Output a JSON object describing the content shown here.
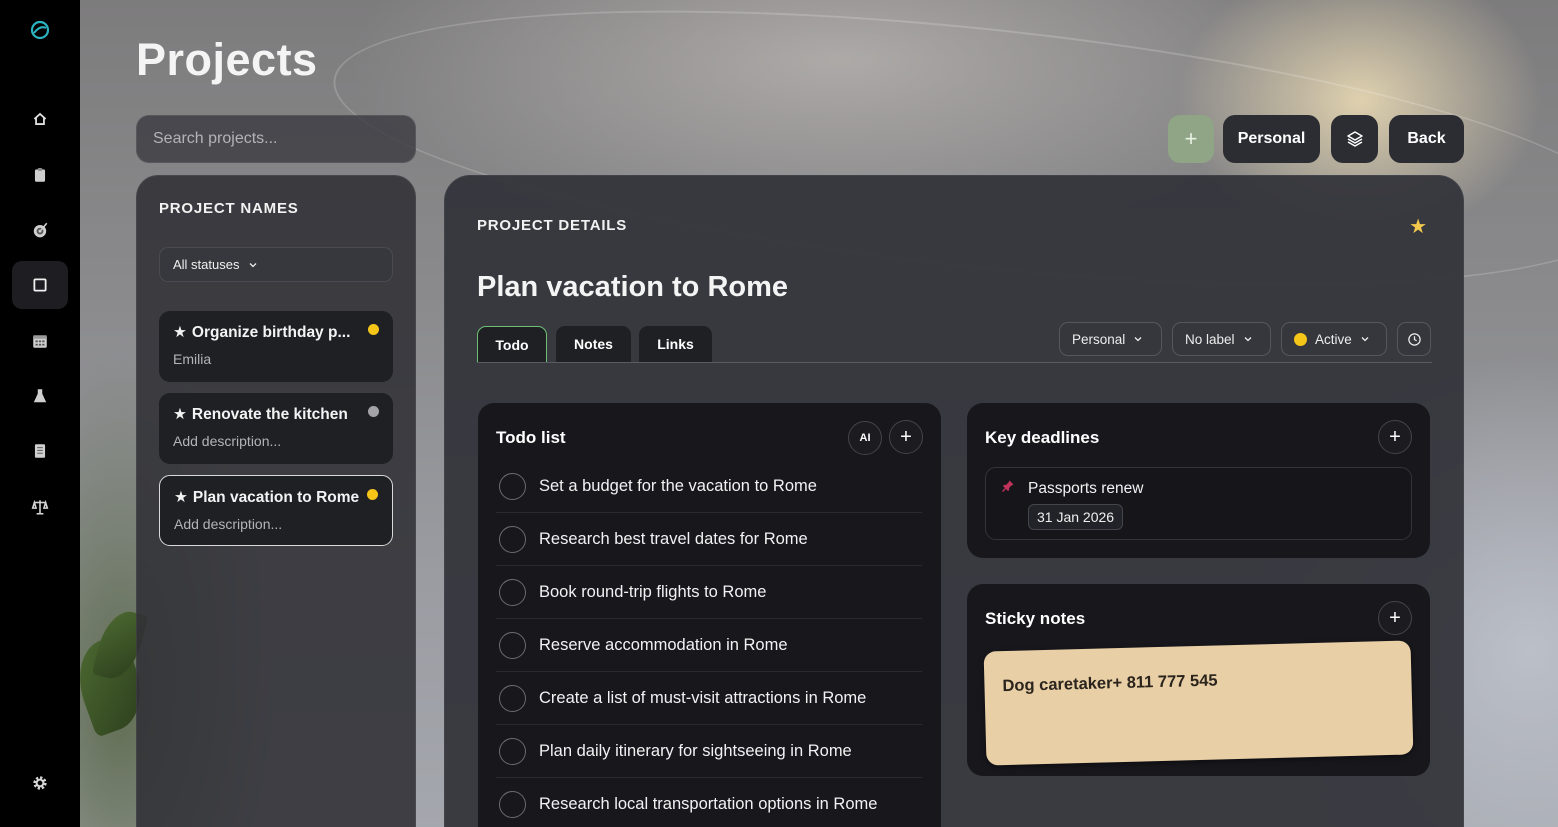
{
  "sidebar": {
    "items": [
      {
        "name": "home-icon",
        "glyph": "⌂"
      },
      {
        "name": "clipboard-icon",
        "glyph": "clipboard"
      },
      {
        "name": "target-icon",
        "glyph": "target"
      },
      {
        "name": "projects-icon",
        "glyph": "square",
        "active": true
      },
      {
        "name": "calendar-icon",
        "glyph": "calendar"
      },
      {
        "name": "flask-icon",
        "glyph": "flask"
      },
      {
        "name": "document-icon",
        "glyph": "document"
      },
      {
        "name": "scale-icon",
        "glyph": "scale"
      }
    ],
    "settings_icon": "gear-icon"
  },
  "header": {
    "title": "Projects",
    "search_placeholder": "Search projects...",
    "add_icon": "plus-icon",
    "personal_label": "Personal",
    "layers_icon": "layers-icon",
    "back_label": "Back"
  },
  "project_list": {
    "heading": "PROJECT NAMES",
    "status_filter": "All statuses",
    "projects": [
      {
        "name": "Organize birthday p...",
        "sub": "Emilia",
        "status_color": "#f5c518"
      },
      {
        "name": "Renovate the kitchen",
        "sub": "Add description...",
        "status_color": "#a3a3a8"
      },
      {
        "name": "Plan vacation to Rome",
        "sub": "Add description...",
        "status_color": "#f5c518"
      }
    ]
  },
  "details": {
    "heading": "PROJECT DETAILS",
    "title": "Plan vacation to Rome",
    "tabs": [
      "Todo",
      "Notes",
      "Links"
    ],
    "active_tab": "Todo",
    "category": "Personal",
    "label": "No label",
    "status": "Active",
    "status_color": "#f5c518"
  },
  "todo": {
    "title": "Todo list",
    "ai_label": "AI",
    "items": [
      "Set a budget for the vacation to Rome",
      "Research best travel dates for Rome",
      "Book round-trip flights to Rome",
      "Reserve accommodation in Rome",
      "Create a list of must-visit attractions in Rome",
      "Plan daily itinerary for sightseeing in Rome",
      "Research local transportation options in Rome"
    ]
  },
  "deadlines": {
    "title": "Key deadlines",
    "items": [
      {
        "name": "Passports renew",
        "date": "31 Jan 2026"
      }
    ]
  },
  "sticky_notes": {
    "title": "Sticky notes",
    "notes": [
      "Dog caretaker+ 811 777 545"
    ]
  },
  "colors": {
    "accent_green": "#6fbf74",
    "star": "#f2c94c",
    "pin": "#c2335c",
    "sticky": "#e8cfa6"
  }
}
